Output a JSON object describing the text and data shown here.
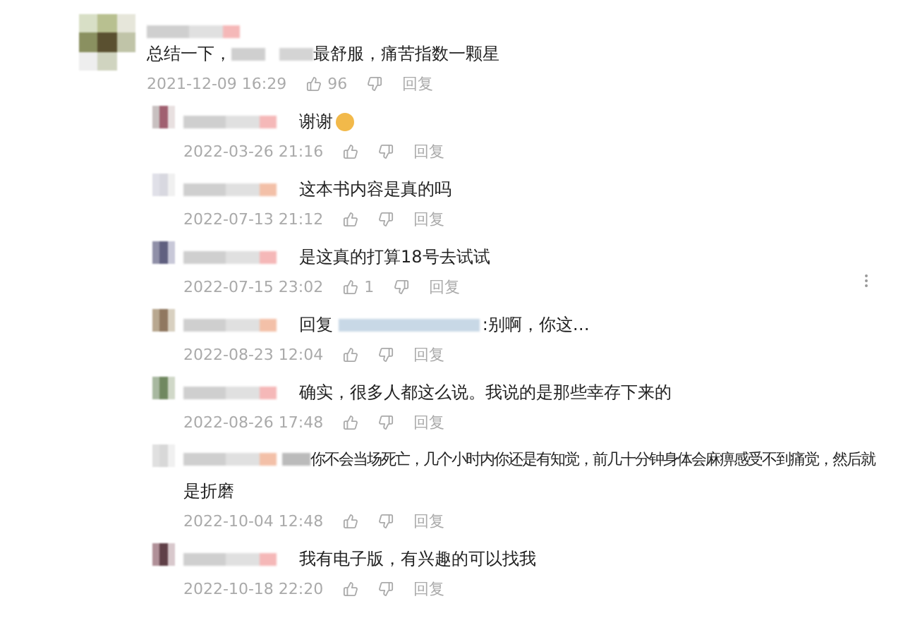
{
  "comment": {
    "text_before": "总结一下，",
    "text_after": "最舒服，痛苦指数一颗星",
    "time": "2021-12-09 16:29",
    "likes": "96",
    "reply_label": "回复"
  },
  "replies": [
    {
      "kind": "plain",
      "text": "谢谢",
      "emoji": true,
      "time": "2022-03-26 21:16",
      "reply_label": "回复",
      "more_menu": false
    },
    {
      "kind": "plain",
      "text": "这本书内容是真的吗",
      "emoji": false,
      "time": "2022-07-13 21:12",
      "reply_label": "回复",
      "more_menu": false
    },
    {
      "kind": "plain",
      "text": "是这真的打算18号去试试",
      "emoji": false,
      "time": "2022-07-15 23:02",
      "likes": "1",
      "reply_label": "回复",
      "more_menu": true
    },
    {
      "kind": "reply_to",
      "prefix": "回复",
      "text": ":别啊，你这…",
      "emoji": false,
      "time": "2022-08-23 12:04",
      "reply_label": "回复",
      "more_menu": false
    },
    {
      "kind": "plain",
      "text": "确实，很多人都这么说。我说的是那些幸存下来的",
      "emoji": false,
      "time": "2022-08-26 17:48",
      "reply_label": "回复",
      "more_menu": false
    },
    {
      "kind": "redacted_prefix",
      "text": "你不会当场死亡，几个小时内你还是有知觉，前几十分钟身体会麻痹感受不到痛觉，然后就",
      "text_line2": "是折磨",
      "emoji": false,
      "time": "2022-10-04 12:48",
      "reply_label": "回复",
      "more_menu": false
    },
    {
      "kind": "plain",
      "text": "我有电子版，有兴趣的可以找我",
      "emoji": false,
      "time": "2022-10-18 22:20",
      "reply_label": "回复",
      "more_menu": false
    }
  ]
}
